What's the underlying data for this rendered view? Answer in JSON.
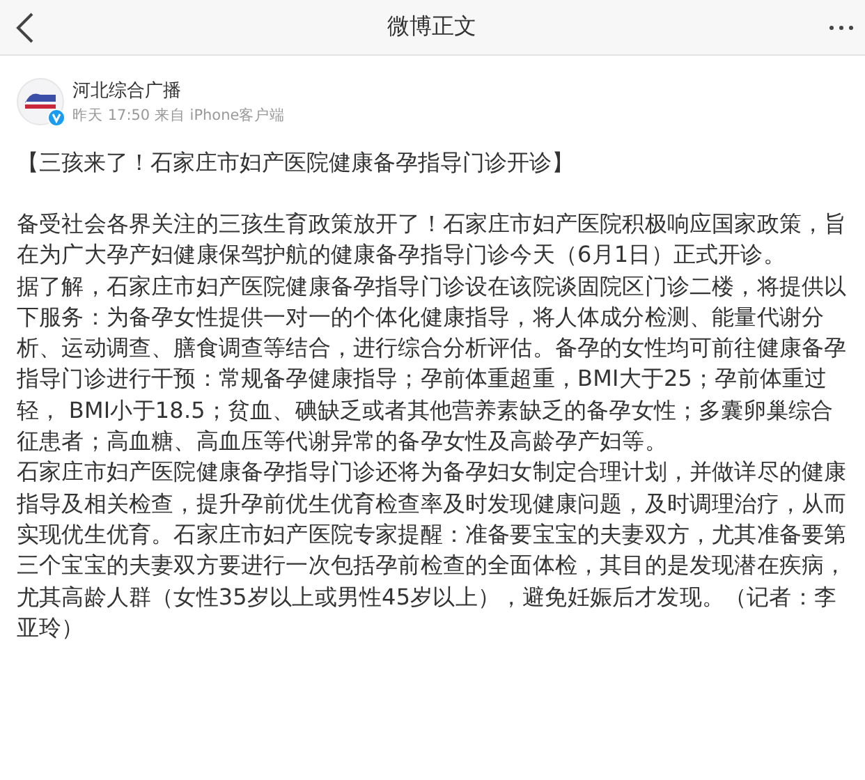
{
  "nav": {
    "title": "微博正文"
  },
  "post": {
    "author": "河北综合广播",
    "verified": true,
    "meta": "昨天 17:50 来自 iPhone客户端",
    "headline": "【三孩来了！石家庄市妇产医院健康备孕指导门诊开诊】",
    "paragraphs": [
      "备受社会各界关注的三孩生育政策放开了！石家庄市妇产医院积极响应国家政策，旨在为广大孕产妇健康保驾护航的健康备孕指导门诊今天（6月1日）正式开诊。",
      "据了解，石家庄市妇产医院健康备孕指导门诊设在该院谈固院区门诊二楼，将提供以下服务：为备孕女性提供一对一的个体化健康指导，将人体成分检测、能量代谢分析、运动调查、膳食调查等结合，进行综合分析评估。备孕的女性均可前往健康备孕指导门诊进行干预：常规备孕健康指导；孕前体重超重，BMI大于25；孕前体重过轻， BMI小于18.5；贫血、碘缺乏或者其他营养素缺乏的备孕女性；多囊卵巢综合征患者；高血糖、高血压等代谢异常的备孕女性及高龄孕产妇等。",
      "石家庄市妇产医院健康备孕指导门诊还将为备孕妇女制定合理计划，并做详尽的健康指导及相关检查，提升孕前优生优育检查率及时发现健康问题，及时调理治疗，从而实现优生优育。石家庄市妇产医院专家提醒：准备要宝宝的夫妻双方，尤其准备要第三个宝宝的夫妻双方要进行一次包括孕前检查的全面体检，其目的是发现潜在疾病，尤其高龄人群（女性35岁以上或男性45岁以上），避免妊娠后才发现。（记者：李亚玲）"
    ]
  }
}
